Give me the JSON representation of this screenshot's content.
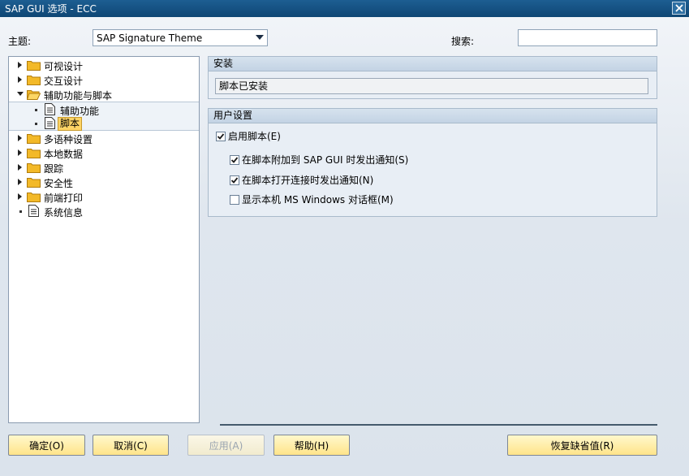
{
  "window": {
    "title": "SAP GUI 选项 - ECC"
  },
  "top": {
    "theme_label": "主题:",
    "theme_value": "SAP Signature Theme",
    "search_label": "搜索:",
    "search_value": ""
  },
  "tree": {
    "items": [
      {
        "label": "可视设计"
      },
      {
        "label": "交互设计"
      },
      {
        "label": "辅助功能与脚本"
      },
      {
        "label": "辅助功能"
      },
      {
        "label": "脚本"
      },
      {
        "label": "多语种设置"
      },
      {
        "label": "本地数据"
      },
      {
        "label": "跟踪"
      },
      {
        "label": "安全性"
      },
      {
        "label": "前端打印"
      },
      {
        "label": "系统信息"
      }
    ]
  },
  "install_group": {
    "title": "安装",
    "status": "脚本已安装"
  },
  "user_group": {
    "title": "用户设置",
    "enable_scripting": "启用脚本(E)",
    "notify_attach": "在脚本附加到 SAP GUI 时发出通知(S)",
    "notify_connection": "在脚本打开连接时发出通知(N)",
    "native_dialogs": "显示本机 MS Windows 对话框(M)"
  },
  "buttons": {
    "ok": "确定(O)",
    "cancel": "取消(C)",
    "apply": "应用(A)",
    "help": "帮助(H)",
    "restore_defaults": "恢复缺省值(R)"
  },
  "colors": {
    "title_bar": "#0f4674",
    "selection": "#ffd466",
    "button": "#ffe48a"
  }
}
